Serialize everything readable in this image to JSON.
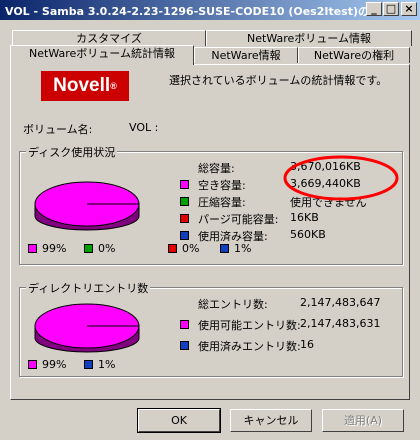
{
  "window": {
    "title": "VOL - Samba 3.0.24-2.23-1296-SUSE-CODE10 (Oes2Itest)の...",
    "controls": [
      "_",
      "□",
      "×"
    ]
  },
  "tabs": {
    "row_back": [
      "カスタマイズ",
      "NetWareボリューム情報"
    ],
    "row_front": [
      "NetWareボリューム統計情報",
      "NetWare情報",
      "NetWareの権利"
    ]
  },
  "header": {
    "logo_text": "Novell",
    "logo_mark": "®",
    "description": "選択されているボリュームの統計情報です。"
  },
  "volume": {
    "name_label": "ボリューム名:",
    "vol_label": "VOL :"
  },
  "disk_usage": {
    "title": "ディスク使用状況",
    "rows": [
      {
        "label": "総容量:",
        "value": "3,670,016KB",
        "color": ""
      },
      {
        "label": "空き容量:",
        "value": "3,669,440KB",
        "color": "#ff00ff"
      },
      {
        "label": "圧縮容量:",
        "value": "使用できません",
        "color": "#00a000"
      },
      {
        "label": "パージ可能容量:",
        "value": "16KB",
        "color": "#e00000"
      },
      {
        "label": "使用済み容量:",
        "value": "560KB",
        "color": "#1040c0"
      }
    ],
    "legend": [
      {
        "label": "99%",
        "color": "#ff00ff"
      },
      {
        "label": "0%",
        "color": "#00a000"
      },
      {
        "label": "0%",
        "color": "#e00000"
      },
      {
        "label": "1%",
        "color": "#1040c0"
      }
    ]
  },
  "directory": {
    "title": "ディレクトリエントリ数",
    "rows": [
      {
        "label": "総エントリ数:",
        "value": "2,147,483,647",
        "color": ""
      },
      {
        "label": "使用可能エントリ数:",
        "value": "2,147,483,631",
        "color": "#ff00ff"
      },
      {
        "label": "使用済みエントリ数:",
        "value": "16",
        "color": "#1040c0"
      }
    ],
    "legend": [
      {
        "label": "99%",
        "color": "#ff00ff"
      },
      {
        "label": "1%",
        "color": "#1040c0"
      }
    ]
  },
  "buttons": {
    "ok": "OK",
    "cancel": "キャンセル",
    "apply": "適用(A)"
  }
}
